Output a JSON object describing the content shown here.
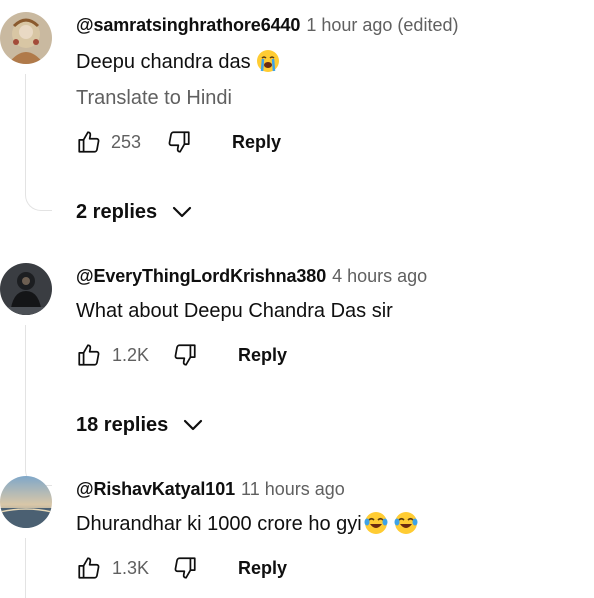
{
  "comments": [
    {
      "author": "@samratsinghrathore6440",
      "time": "1 hour ago (edited)",
      "text": "Deepu chandra das",
      "emoji": [
        "loudly-crying-face"
      ],
      "translate": "Translate to Hindi",
      "likes": "253",
      "reply_label": "Reply",
      "replies_label": "2 replies",
      "avatar": "avatar-goddess-art"
    },
    {
      "author": "@EveryThingLordKrishna380",
      "time": "4 hours ago",
      "text": "What about Deepu Chandra Das sir",
      "likes": "1.2K",
      "reply_label": "Reply",
      "replies_label": "18 replies",
      "avatar": "avatar-dark-figure"
    },
    {
      "author": "@RishavKatyal101",
      "time": "11 hours ago",
      "text": "Dhurandhar ki 1000 crore ho gyi",
      "emoji": [
        "face-with-tears-of-joy",
        "face-with-tears-of-joy"
      ],
      "likes": "1.3K",
      "reply_label": "Reply",
      "avatar": "avatar-beach-sunset"
    }
  ],
  "colors": {
    "primary_text": "#0f0f0f",
    "secondary_text": "#606060",
    "thread_line": "#e3e3e3"
  }
}
